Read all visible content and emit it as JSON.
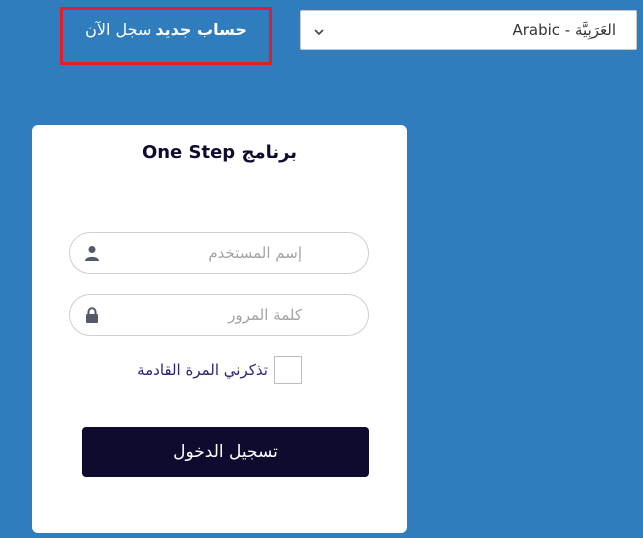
{
  "signup": {
    "link_text": "حساب جديد",
    "prefix_text": "سجل الآن"
  },
  "language_select": {
    "selected": "Arabic - العَرَبِيَّة"
  },
  "login_card": {
    "title": "برنامج One Step",
    "username_placeholder": "إسم المستخدم",
    "password_placeholder": "كلمة المرور",
    "remember_label": "تذكرني المرة القادمة",
    "submit_label": "تسجيل الدخول"
  },
  "icons": {
    "username": "user-icon",
    "password": "lock-icon",
    "select": "chevron-down-icon"
  },
  "colors": {
    "background": "#2f7dbd",
    "highlight_border": "#e01e2a",
    "button": "#0e0b2e",
    "remember_text": "#2c2277"
  }
}
